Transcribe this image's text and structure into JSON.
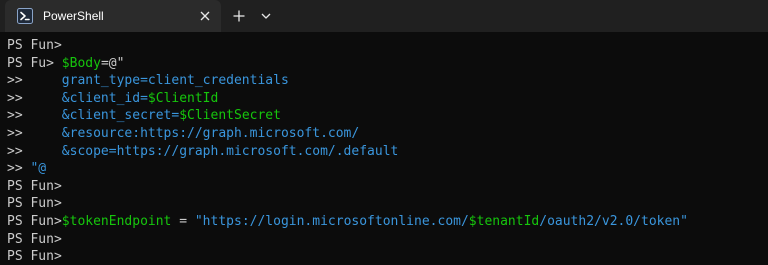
{
  "app": {
    "tab_title": "PowerShell",
    "tab_icon": "powershell-icon",
    "close_icon": "close-icon",
    "new_tab_icon": "plus-icon",
    "dropdown_icon": "chevron-down-icon"
  },
  "colors": {
    "background": "#0c0c0c",
    "tab_strip": "#202020",
    "active_tab": "#2b2b2b",
    "default_text": "#cccccc",
    "variable": "#16c60c",
    "string": "#3a96dd"
  },
  "terminal": {
    "lines": [
      [
        {
          "text": "PS Fun>",
          "color": "default"
        }
      ],
      [
        {
          "text": "PS Fu> ",
          "color": "default"
        },
        {
          "text": "$Body",
          "color": "green"
        },
        {
          "text": "=@\"",
          "color": "default"
        }
      ],
      [
        {
          "text": ">>     ",
          "color": "default"
        },
        {
          "text": "grant_type=client_credentials",
          "color": "blue"
        }
      ],
      [
        {
          "text": ">>     ",
          "color": "default"
        },
        {
          "text": "&client_id=",
          "color": "blue"
        },
        {
          "text": "$ClientId",
          "color": "green"
        }
      ],
      [
        {
          "text": ">>     ",
          "color": "default"
        },
        {
          "text": "&client_secret=",
          "color": "blue"
        },
        {
          "text": "$ClientSecret",
          "color": "green"
        }
      ],
      [
        {
          "text": ">>     ",
          "color": "default"
        },
        {
          "text": "&resource:https://graph.microsoft.com/",
          "color": "blue"
        }
      ],
      [
        {
          "text": ">>     ",
          "color": "default"
        },
        {
          "text": "&scope=https://graph.microsoft.com/.default",
          "color": "blue"
        }
      ],
      [
        {
          "text": ">> ",
          "color": "default"
        },
        {
          "text": "\"@",
          "color": "blue"
        }
      ],
      [
        {
          "text": "PS Fun>",
          "color": "default"
        }
      ],
      [
        {
          "text": "PS Fun>",
          "color": "default"
        }
      ],
      [
        {
          "text": "PS Fun>",
          "color": "default"
        },
        {
          "text": "$tokenEndpoint",
          "color": "green"
        },
        {
          "text": " = ",
          "color": "default"
        },
        {
          "text": "\"https://login.microsoftonline.com/",
          "color": "blue"
        },
        {
          "text": "$tenantId",
          "color": "green"
        },
        {
          "text": "/oauth2/v2.0/token\"",
          "color": "blue"
        }
      ],
      [
        {
          "text": "PS Fun>",
          "color": "default"
        }
      ],
      [
        {
          "text": "PS Fun>",
          "color": "default"
        }
      ]
    ]
  }
}
